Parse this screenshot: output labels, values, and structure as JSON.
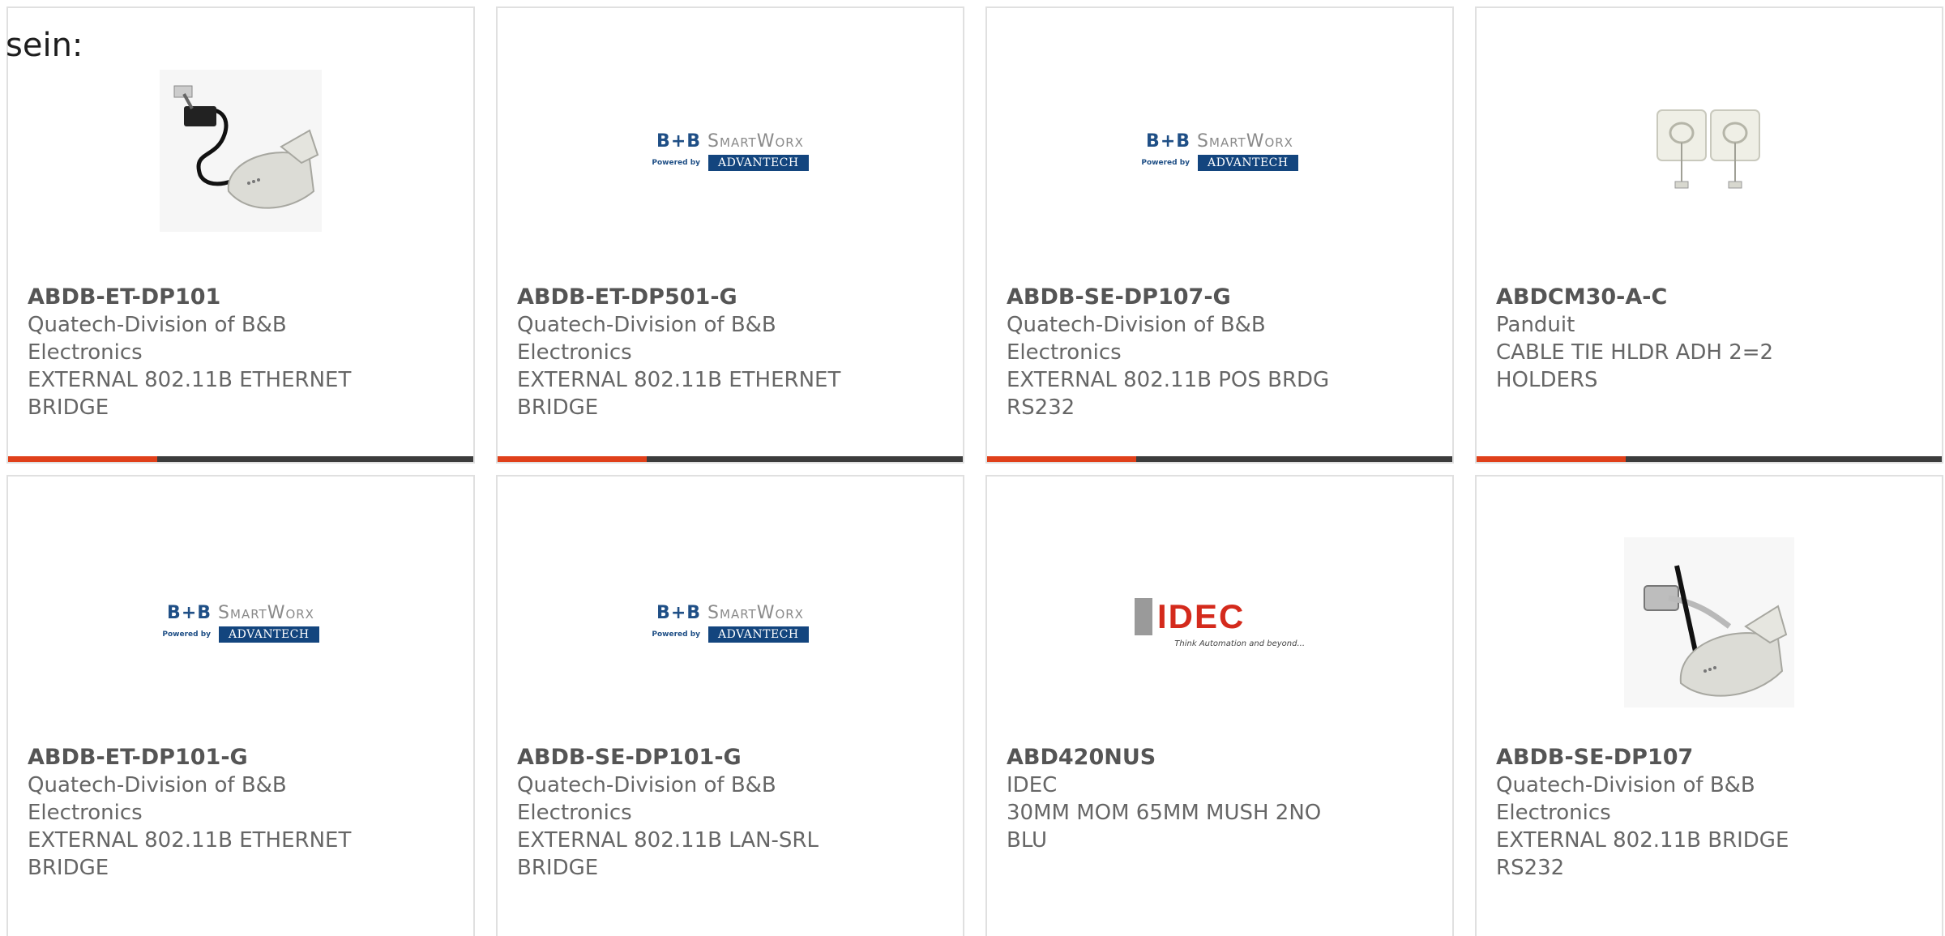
{
  "intro_text": "sein:",
  "products": [
    {
      "part": "ABDB-ET-DP101",
      "manufacturer": "Quatech-Division of B&B\nElectronics",
      "description": "EXTERNAL 802.11B ETHERNET\nBRIDGE",
      "image": "product-photo"
    },
    {
      "part": "ABDB-ET-DP501-G",
      "manufacturer": "Quatech-Division of B&B\nElectronics",
      "description": "EXTERNAL 802.11B ETHERNET\nBRIDGE",
      "image": "bb-logo"
    },
    {
      "part": "ABDB-SE-DP107-G",
      "manufacturer": "Quatech-Division of B&B\nElectronics",
      "description": "EXTERNAL 802.11B POS BRDG\nRS232",
      "image": "bb-logo"
    },
    {
      "part": "ABDCM30-A-C",
      "manufacturer": "Panduit",
      "description": "CABLE TIE HLDR ADH 2=2\nHOLDERS",
      "image": "product-photo"
    },
    {
      "part": "ABDB-ET-DP101-G",
      "manufacturer": "Quatech-Division of B&B\nElectronics",
      "description": "EXTERNAL 802.11B ETHERNET\nBRIDGE",
      "image": "bb-logo"
    },
    {
      "part": "ABDB-SE-DP101-G",
      "manufacturer": "Quatech-Division of B&B\nElectronics",
      "description": "EXTERNAL 802.11B LAN-SRL\nBRIDGE",
      "image": "bb-logo"
    },
    {
      "part": "ABD420NUS",
      "manufacturer": "IDEC",
      "description": "30MM MOM 65MM MUSH 2NO\nBLU",
      "image": "idec-logo"
    },
    {
      "part": "ABDB-SE-DP107",
      "manufacturer": "Quatech-Division of B&B\nElectronics",
      "description": "EXTERNAL 802.11B BRIDGE\nRS232",
      "image": "product-photo"
    }
  ],
  "logos": {
    "bb": {
      "brand": "B+B",
      "name": "SmartWorx",
      "powered": "Powered by",
      "partner": "ADVANTECH"
    },
    "idec": {
      "name": "IDEC",
      "tagline": "Think Automation and beyond..."
    }
  },
  "colors": {
    "accent": "#e0401a",
    "bar": "#3c3c3c",
    "text": "#666666"
  }
}
